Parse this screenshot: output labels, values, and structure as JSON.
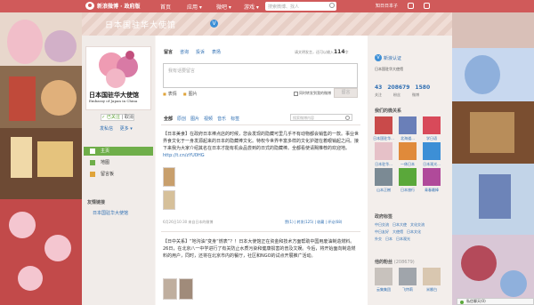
{
  "topbar": {
    "logo": "新浪微博 · 政府版",
    "nav": [
      "首页",
      "应用 ▾",
      "微吧 ▾",
      "游戏 ▾"
    ],
    "search_placeholder": "搜索微博、找人",
    "user": "知日日本子",
    "bar_color": "#d05a5a"
  },
  "banner": {
    "title": "日本国驻华大使馆",
    "badge": "V"
  },
  "profile": {
    "name_cn": "日本国驻华大使馆",
    "name_en": "Embassy of Japan in China",
    "follow": "✓ 已关注",
    "follow_sep": "|",
    "follow_action": "取消",
    "links": [
      "发私信",
      "更多 ▾"
    ]
  },
  "left_nav": [
    {
      "label": "主页",
      "icon": "home-icon"
    },
    {
      "label": "地图",
      "icon": "map-icon"
    },
    {
      "label": "留言板",
      "icon": "message-board-icon"
    }
  ],
  "friends": {
    "heading": "友情链接",
    "link": "日本国驻华大使馆"
  },
  "composer": {
    "tabs": [
      "留言",
      "咨询",
      "投诉",
      "表扬"
    ],
    "counter_prefix": "请文明发言，还可以输入",
    "counter_value": "114",
    "counter_unit": "字",
    "placeholder": "我有话要留言",
    "tools": [
      "表情",
      "图片"
    ],
    "also_post": "同时转发到我的微博",
    "submit": "留言"
  },
  "feed": {
    "filters": [
      "全部",
      "原创",
      "图片",
      "视频",
      "音乐",
      "标签"
    ],
    "search_placeholder": "搜索微博内容",
    "posts": [
      {
        "text": "【日本美食】在政府日本棒点店的时候，您会发现的隐藏可里几乎不有动物都会销售的一款。事业世界食文化于一身发源起来的日本的隐藏棒文化。特权今世界丰富多样的文化护建在着眼销起之间。接下来我为大家介绍其名在日本才能有机会品尝到的日式的隐藏棒。全都看使请赐推荐的欢迎地。",
        "link": "http://t.cn/zYU0HG",
        "meta": "6月26日10:30  来自日本的微博",
        "actions": "赞(1) | 转发(125) | 收藏 | 评论(68)"
      },
      {
        "text": "【日中关系】“地沟油“变身“燃表”？！日本大使馆正在资金和技术方面帮助中国用废油制造燃料。26日，在北京八一中学进行了有关防止水质污染和健康损害的普及文娱。今后，将开始面向制造燃料的用户，同时，还将在北京市内的餐厅，社区和NGO的试点开展推广活动。",
        "link": "",
        "meta": "",
        "actions": ""
      }
    ]
  },
  "right_panel": {
    "verify_label": "新浪认证",
    "verify_desc": "日本国驻华大使馆",
    "stats": [
      "43",
      "208679",
      "1580"
    ],
    "stat_labels": [
      "关注",
      "粉丝",
      "微博"
    ],
    "following_head": "我们的微关系",
    "following": [
      "日本国驻华...",
      "北海道...",
      "学日语",
      "日本驻华...",
      "一休日本",
      "日本观光...",
      "山本正樹",
      "日本旅行",
      "青春最棒"
    ],
    "tags_head": "政府标签",
    "tags": [
      [
        "中日交流",
        "日本大使",
        "文化交流"
      ],
      [
        "中日友好",
        "大使馆",
        "日本文化"
      ],
      [
        "外交",
        "日本",
        "日本观光"
      ]
    ],
    "fans_head": "他的粉丝",
    "fans_count": "(208679)",
    "fans": [
      "用户",
      "北京",
      "粉丝"
    ],
    "fans_row": [
      "云集集团",
      "飞特莉",
      "米娜白"
    ]
  },
  "chat": {
    "label": "私信聊天(0)"
  }
}
